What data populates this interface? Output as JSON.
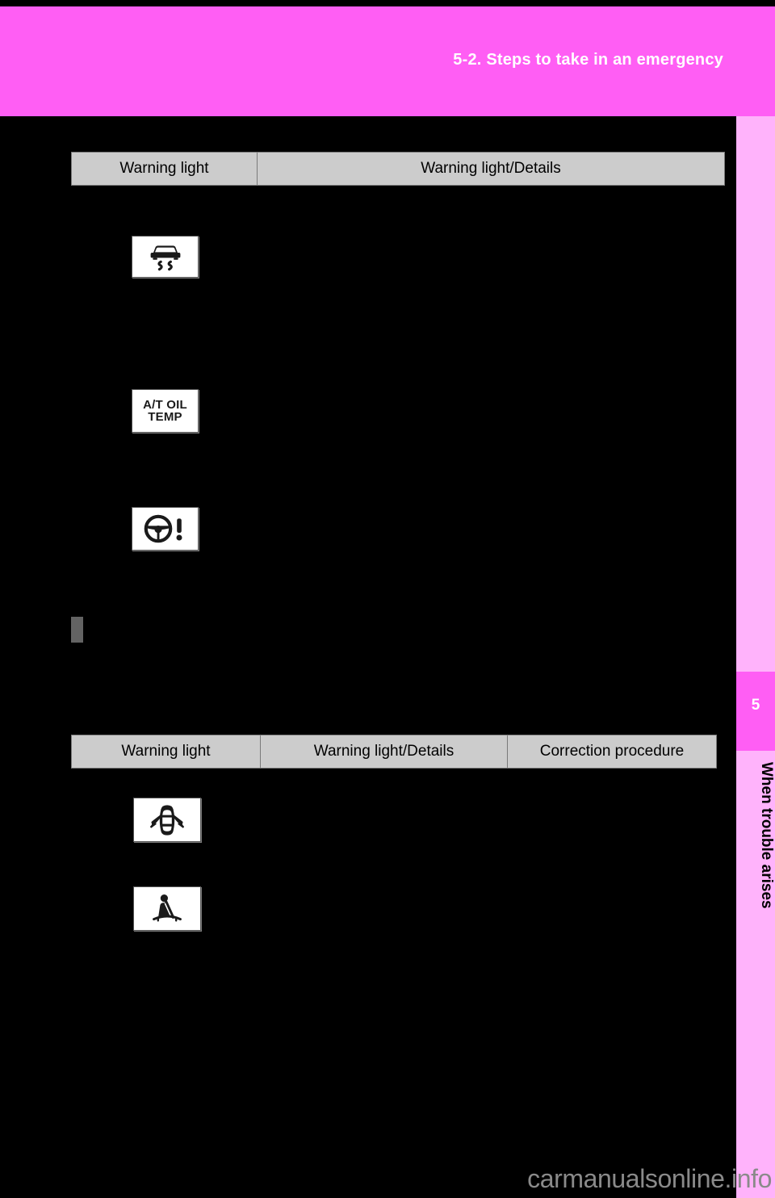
{
  "page": {
    "background_color": "#000000",
    "header_color": "#ff5ef4",
    "side_tab_color": "#ffb3fb",
    "table_header_color": "#cccccc"
  },
  "header": {
    "title": "5-2. Steps to take in an emergency"
  },
  "side_tab": {
    "chapter_number": "5",
    "chapter_label": "When trouble arises"
  },
  "tables": [
    {
      "name": "warning-light-table-1",
      "columns": [
        "Warning light",
        "Warning light/Details"
      ],
      "rows": [
        {
          "icon": "vsc-skid-warning-icon",
          "icon_text": ""
        },
        {
          "icon": "at-oil-temp-warning-icon",
          "icon_text": "A/T OIL\nTEMP"
        },
        {
          "icon": "eps-steering-warning-icon",
          "icon_text": ""
        }
      ]
    },
    {
      "name": "warning-light-table-2",
      "columns": [
        "Warning light",
        "Warning light/Details",
        "Correction procedure"
      ],
      "rows": [
        {
          "icon": "open-door-warning-icon",
          "icon_text": ""
        },
        {
          "icon": "seat-belt-reminder-icon",
          "icon_text": ""
        }
      ]
    }
  ],
  "icons": {
    "at_oil_temp_line1": "A/T OIL",
    "at_oil_temp_line2": "TEMP"
  },
  "watermark": {
    "text": "carmanualsonline.info"
  }
}
